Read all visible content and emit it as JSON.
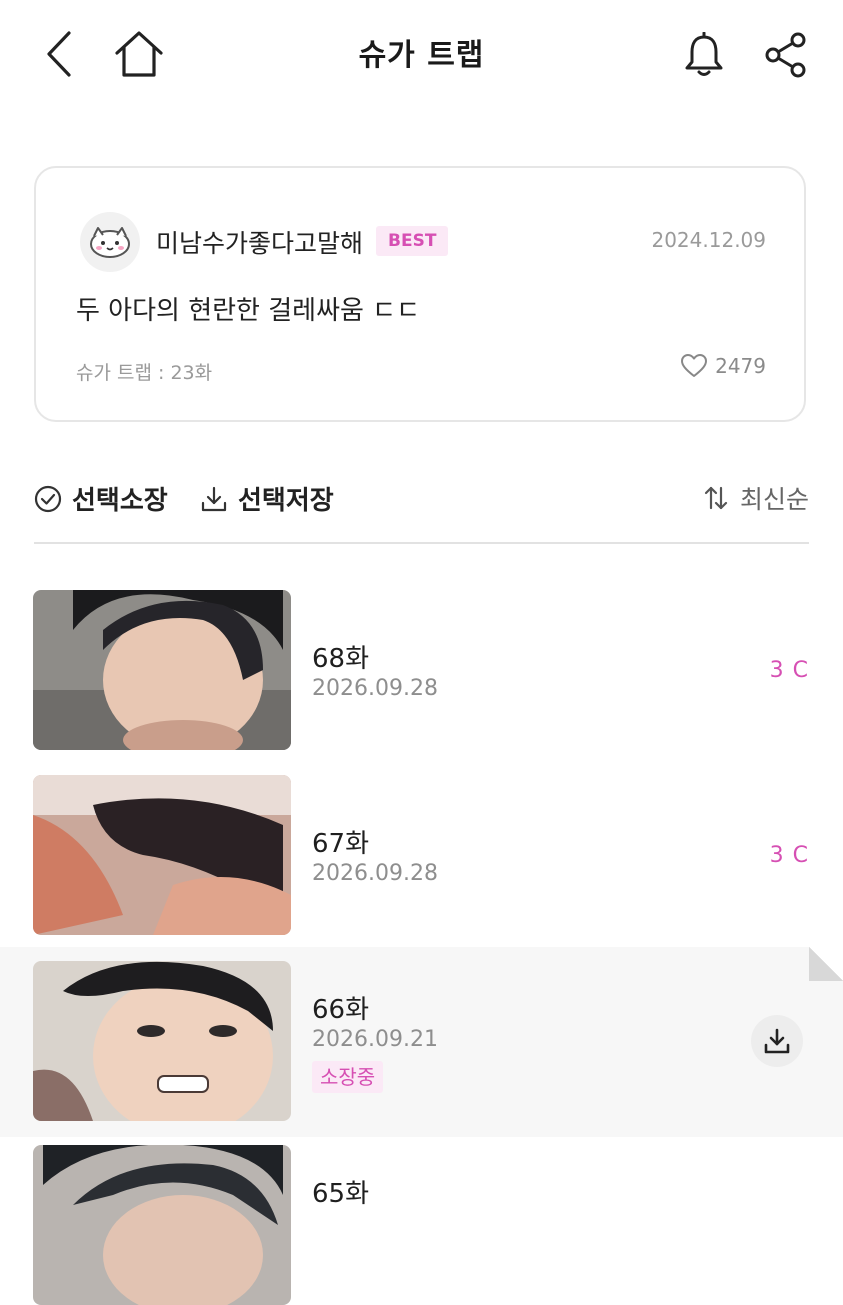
{
  "header": {
    "title": "슈가 트랩"
  },
  "best_comment": {
    "username": "미남수가좋다고말해",
    "badge": "BEST",
    "date": "2024.12.09",
    "text": "두 아다의 현란한 걸레싸움 ㄷㄷ",
    "episode_ref": "슈가 트랩 : 23화",
    "likes": "2479"
  },
  "toolbar": {
    "select_own": "선택소장",
    "select_save": "선택저장",
    "sort": "최신순"
  },
  "episodes": [
    {
      "title": "68화",
      "date": "2026.09.28",
      "price": "3 C"
    },
    {
      "title": "67화",
      "date": "2026.09.28",
      "price": "3 C"
    },
    {
      "title": "66화",
      "date": "2026.09.21",
      "status": "소장중"
    },
    {
      "title": "65화"
    }
  ],
  "icons": {
    "back": "chevron-left-icon",
    "home": "home-icon",
    "bell": "bell-icon",
    "share": "share-icon",
    "like": "heart-icon",
    "check": "check-circle-icon",
    "download": "download-icon",
    "sort": "sort-icon"
  },
  "colors": {
    "accent": "#d64fb3",
    "badge_bg": "#fbe9f6",
    "muted_text": "#8e8e8e",
    "highlight_row": "#f7f7f7"
  }
}
